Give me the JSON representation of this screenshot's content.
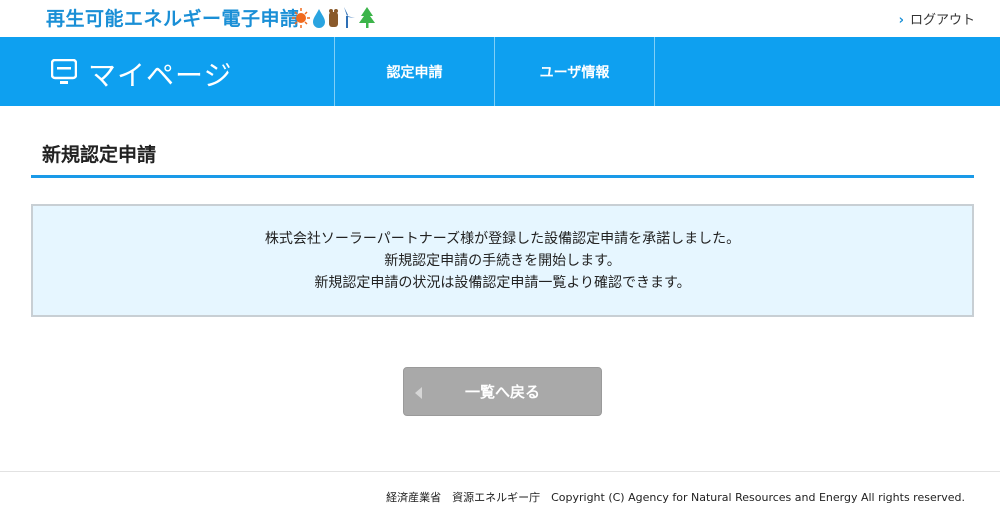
{
  "header": {
    "site_title": "再生可能エネルギー電子申請",
    "mascot_icon": "renewable-mascots-icon",
    "logout_label": "ログアウト"
  },
  "nav": {
    "mypage_label": "マイページ",
    "tabs": [
      {
        "label": "認定申請"
      },
      {
        "label": "ユーザ情報"
      }
    ]
  },
  "main": {
    "page_title": "新規認定申請",
    "message_lines": [
      "株式会社ソーラーパートナーズ様が登録した設備認定申請を承諾しました。",
      "新規認定申請の手続きを開始します。",
      "新規認定申請の状況は設備認定申請一覧より確認できます。"
    ],
    "back_button_label": "一覧へ戻る"
  },
  "footer": {
    "agency_name": "経済産業省　資源エネルギー庁",
    "copyright": "Copyright (C) Agency for Natural Resources and Energy All rights reserved."
  },
  "colors": {
    "nav_bg": "#0ea0f0",
    "title_blue": "#1a8fd6",
    "message_bg": "#e6f6ff",
    "button_disabled": "#a9a9a9"
  }
}
